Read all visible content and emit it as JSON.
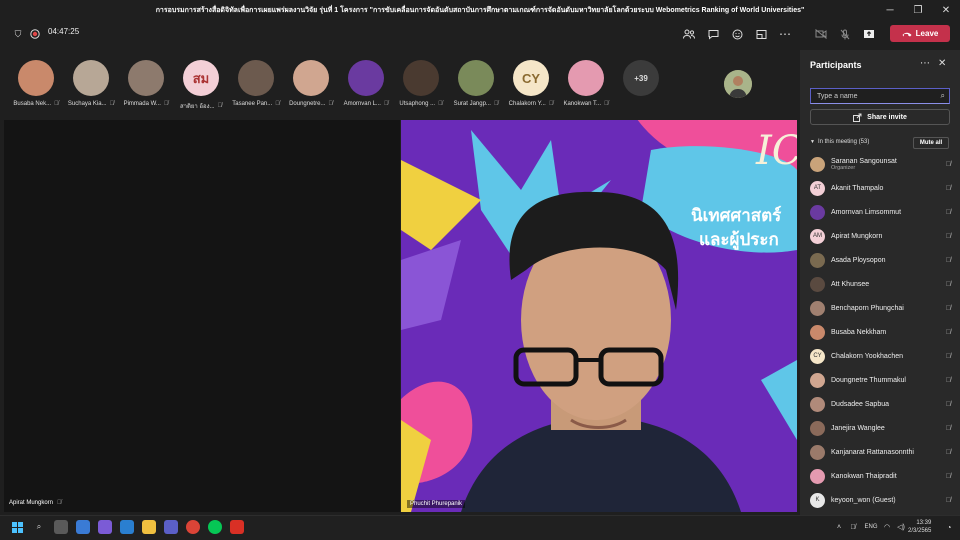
{
  "window": {
    "title": "การอบรมการสร้างสื่อดิจิทัลเพื่อการเผยแพร่ผลงานวิจัย รุ่นที่ 1 โครงการ \"การขับเคลื่อนการจัดอันดับสถาบันการศึกษาตามเกณฑ์การจัดอันดับมหาวิทยาลัยโลกด้วยระบบ Webometrics Ranking of World Universities\""
  },
  "toolbar": {
    "timer": "04:47:25",
    "leave_label": "Leave"
  },
  "strip": {
    "tiles": [
      {
        "name": "Busaba Nek...",
        "initials": "",
        "color": "#c9896b"
      },
      {
        "name": "Suchaya Kia...",
        "initials": "",
        "color": "#b7a796"
      },
      {
        "name": "Pimmada W...",
        "initials": "",
        "color": "#8d7a6d"
      },
      {
        "name": "สาติยา อ้อง...",
        "initials": "สม",
        "color": "#f3cfd6"
      },
      {
        "name": "Tasanee Pan...",
        "initials": "",
        "color": "#6c5a4e"
      },
      {
        "name": "Doungnetre...",
        "initials": "",
        "color": "#d0a690"
      },
      {
        "name": "Amornvan L...",
        "initials": "",
        "color": "#6a3aa0"
      },
      {
        "name": "Utsaphong ...",
        "initials": "",
        "color": "#4a3a30"
      },
      {
        "name": "Surat Jangp...",
        "initials": "",
        "color": "#7a8a5a"
      },
      {
        "name": "Chalakorn Y...",
        "initials": "CY",
        "color": "#f5e6c8"
      },
      {
        "name": "Kanokwan T...",
        "initials": "",
        "color": "#e49ab0"
      }
    ],
    "more_label": "+39"
  },
  "main": {
    "left_name": "Apirat Mungkorn",
    "right_name": "Phuchit Phurepanik",
    "slide_text_1": "IC",
    "slide_text_2": "นิเทศศาสตร์",
    "slide_text_3": "และผู้ประก"
  },
  "panel": {
    "title": "Participants",
    "search_placeholder": "Type a name",
    "invite_label": "Share invite",
    "in_meeting": "In this meeting (53)",
    "mute_all": "Mute all",
    "participants": [
      {
        "name": "Saranan Sangounsat",
        "sub": "Organizer",
        "initials": "",
        "color": "#c9a37a"
      },
      {
        "name": "Akanit Thampalo",
        "sub": "",
        "initials": "AT",
        "color": "#f3cfd6"
      },
      {
        "name": "Amornvan Limsommut",
        "sub": "",
        "initials": "",
        "color": "#6a3aa0"
      },
      {
        "name": "Apirat Mungkorn",
        "sub": "",
        "initials": "AM",
        "color": "#f3cfd6"
      },
      {
        "name": "Asada Ploysopon",
        "sub": "",
        "initials": "",
        "color": "#7a6a50"
      },
      {
        "name": "Att Khunsee",
        "sub": "",
        "initials": "",
        "color": "#5a4a40"
      },
      {
        "name": "Benchaporn Phungchai",
        "sub": "",
        "initials": "",
        "color": "#a08070"
      },
      {
        "name": "Busaba Nekkham",
        "sub": "",
        "initials": "",
        "color": "#c9896b"
      },
      {
        "name": "Chalakorn Yookhachen",
        "sub": "",
        "initials": "CY",
        "color": "#f5e6c8"
      },
      {
        "name": "Doungnetre Thummakul",
        "sub": "",
        "initials": "",
        "color": "#d0a690"
      },
      {
        "name": "Dudsadee Sapbua",
        "sub": "",
        "initials": "",
        "color": "#b08a7a"
      },
      {
        "name": "Janejira Wanglee",
        "sub": "",
        "initials": "",
        "color": "#8a6a5a"
      },
      {
        "name": "Kanjanarat Rattanasonnthi",
        "sub": "",
        "initials": "",
        "color": "#9a7a6a"
      },
      {
        "name": "Kanokwan Thaipradit",
        "sub": "",
        "initials": "",
        "color": "#e49ab0"
      },
      {
        "name": "keyoon_won (Guest)",
        "sub": "",
        "initials": "K",
        "color": "#e8e8e8"
      }
    ]
  },
  "taskbar": {
    "time": "13:39",
    "date": "2/3/2565"
  }
}
